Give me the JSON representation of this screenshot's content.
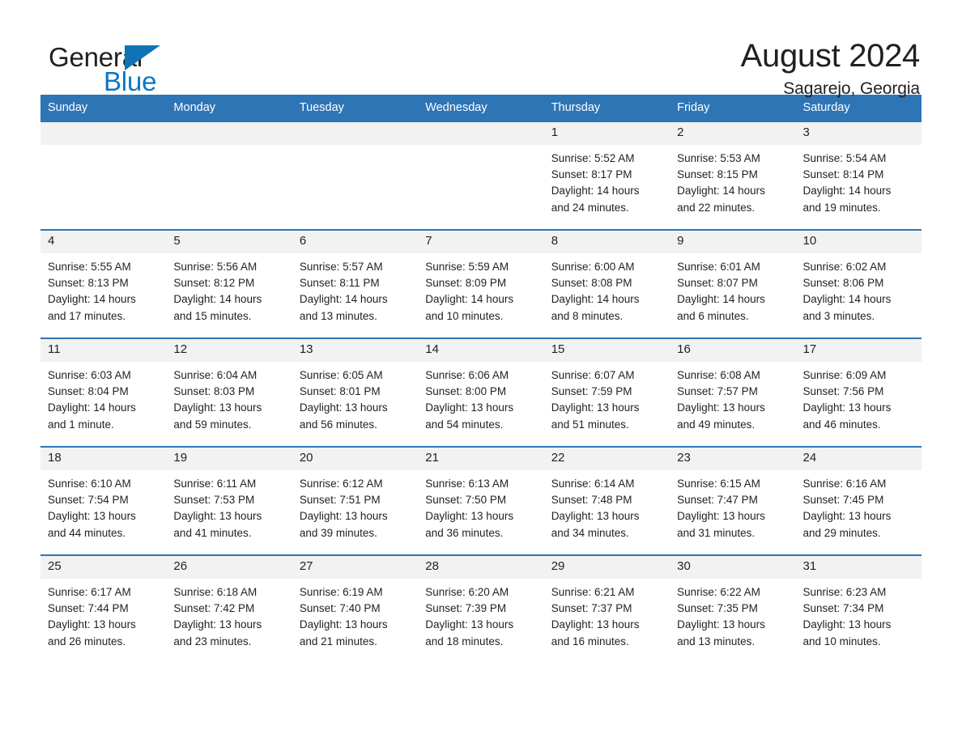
{
  "brand": {
    "word_one": "General",
    "word_two": "Blue",
    "triangle_icon": "triangle-icon",
    "accent_color": "#1073b6",
    "text_color": "#231f20"
  },
  "header": {
    "title": "August 2024",
    "subtitle": "Sagarejo, Georgia"
  },
  "theme": {
    "header_bg": "#2e75b6",
    "header_text": "#ffffff",
    "daynum_bg": "#f2f2f2",
    "body_text": "#231f20"
  },
  "weekdays": [
    "Sunday",
    "Monday",
    "Tuesday",
    "Wednesday",
    "Thursday",
    "Friday",
    "Saturday"
  ],
  "weeks": [
    [
      {
        "day": "",
        "blank": true
      },
      {
        "day": "",
        "blank": true
      },
      {
        "day": "",
        "blank": true
      },
      {
        "day": "",
        "blank": true
      },
      {
        "day": "1",
        "sunrise": "Sunrise: 5:52 AM",
        "sunset": "Sunset: 8:17 PM",
        "daylight_line1": "Daylight: 14 hours",
        "daylight_line2": "and 24 minutes."
      },
      {
        "day": "2",
        "sunrise": "Sunrise: 5:53 AM",
        "sunset": "Sunset: 8:15 PM",
        "daylight_line1": "Daylight: 14 hours",
        "daylight_line2": "and 22 minutes."
      },
      {
        "day": "3",
        "sunrise": "Sunrise: 5:54 AM",
        "sunset": "Sunset: 8:14 PM",
        "daylight_line1": "Daylight: 14 hours",
        "daylight_line2": "and 19 minutes."
      }
    ],
    [
      {
        "day": "4",
        "sunrise": "Sunrise: 5:55 AM",
        "sunset": "Sunset: 8:13 PM",
        "daylight_line1": "Daylight: 14 hours",
        "daylight_line2": "and 17 minutes."
      },
      {
        "day": "5",
        "sunrise": "Sunrise: 5:56 AM",
        "sunset": "Sunset: 8:12 PM",
        "daylight_line1": "Daylight: 14 hours",
        "daylight_line2": "and 15 minutes."
      },
      {
        "day": "6",
        "sunrise": "Sunrise: 5:57 AM",
        "sunset": "Sunset: 8:11 PM",
        "daylight_line1": "Daylight: 14 hours",
        "daylight_line2": "and 13 minutes."
      },
      {
        "day": "7",
        "sunrise": "Sunrise: 5:59 AM",
        "sunset": "Sunset: 8:09 PM",
        "daylight_line1": "Daylight: 14 hours",
        "daylight_line2": "and 10 minutes."
      },
      {
        "day": "8",
        "sunrise": "Sunrise: 6:00 AM",
        "sunset": "Sunset: 8:08 PM",
        "daylight_line1": "Daylight: 14 hours",
        "daylight_line2": "and 8 minutes."
      },
      {
        "day": "9",
        "sunrise": "Sunrise: 6:01 AM",
        "sunset": "Sunset: 8:07 PM",
        "daylight_line1": "Daylight: 14 hours",
        "daylight_line2": "and 6 minutes."
      },
      {
        "day": "10",
        "sunrise": "Sunrise: 6:02 AM",
        "sunset": "Sunset: 8:06 PM",
        "daylight_line1": "Daylight: 14 hours",
        "daylight_line2": "and 3 minutes."
      }
    ],
    [
      {
        "day": "11",
        "sunrise": "Sunrise: 6:03 AM",
        "sunset": "Sunset: 8:04 PM",
        "daylight_line1": "Daylight: 14 hours",
        "daylight_line2": "and 1 minute."
      },
      {
        "day": "12",
        "sunrise": "Sunrise: 6:04 AM",
        "sunset": "Sunset: 8:03 PM",
        "daylight_line1": "Daylight: 13 hours",
        "daylight_line2": "and 59 minutes."
      },
      {
        "day": "13",
        "sunrise": "Sunrise: 6:05 AM",
        "sunset": "Sunset: 8:01 PM",
        "daylight_line1": "Daylight: 13 hours",
        "daylight_line2": "and 56 minutes."
      },
      {
        "day": "14",
        "sunrise": "Sunrise: 6:06 AM",
        "sunset": "Sunset: 8:00 PM",
        "daylight_line1": "Daylight: 13 hours",
        "daylight_line2": "and 54 minutes."
      },
      {
        "day": "15",
        "sunrise": "Sunrise: 6:07 AM",
        "sunset": "Sunset: 7:59 PM",
        "daylight_line1": "Daylight: 13 hours",
        "daylight_line2": "and 51 minutes."
      },
      {
        "day": "16",
        "sunrise": "Sunrise: 6:08 AM",
        "sunset": "Sunset: 7:57 PM",
        "daylight_line1": "Daylight: 13 hours",
        "daylight_line2": "and 49 minutes."
      },
      {
        "day": "17",
        "sunrise": "Sunrise: 6:09 AM",
        "sunset": "Sunset: 7:56 PM",
        "daylight_line1": "Daylight: 13 hours",
        "daylight_line2": "and 46 minutes."
      }
    ],
    [
      {
        "day": "18",
        "sunrise": "Sunrise: 6:10 AM",
        "sunset": "Sunset: 7:54 PM",
        "daylight_line1": "Daylight: 13 hours",
        "daylight_line2": "and 44 minutes."
      },
      {
        "day": "19",
        "sunrise": "Sunrise: 6:11 AM",
        "sunset": "Sunset: 7:53 PM",
        "daylight_line1": "Daylight: 13 hours",
        "daylight_line2": "and 41 minutes."
      },
      {
        "day": "20",
        "sunrise": "Sunrise: 6:12 AM",
        "sunset": "Sunset: 7:51 PM",
        "daylight_line1": "Daylight: 13 hours",
        "daylight_line2": "and 39 minutes."
      },
      {
        "day": "21",
        "sunrise": "Sunrise: 6:13 AM",
        "sunset": "Sunset: 7:50 PM",
        "daylight_line1": "Daylight: 13 hours",
        "daylight_line2": "and 36 minutes."
      },
      {
        "day": "22",
        "sunrise": "Sunrise: 6:14 AM",
        "sunset": "Sunset: 7:48 PM",
        "daylight_line1": "Daylight: 13 hours",
        "daylight_line2": "and 34 minutes."
      },
      {
        "day": "23",
        "sunrise": "Sunrise: 6:15 AM",
        "sunset": "Sunset: 7:47 PM",
        "daylight_line1": "Daylight: 13 hours",
        "daylight_line2": "and 31 minutes."
      },
      {
        "day": "24",
        "sunrise": "Sunrise: 6:16 AM",
        "sunset": "Sunset: 7:45 PM",
        "daylight_line1": "Daylight: 13 hours",
        "daylight_line2": "and 29 minutes."
      }
    ],
    [
      {
        "day": "25",
        "sunrise": "Sunrise: 6:17 AM",
        "sunset": "Sunset: 7:44 PM",
        "daylight_line1": "Daylight: 13 hours",
        "daylight_line2": "and 26 minutes."
      },
      {
        "day": "26",
        "sunrise": "Sunrise: 6:18 AM",
        "sunset": "Sunset: 7:42 PM",
        "daylight_line1": "Daylight: 13 hours",
        "daylight_line2": "and 23 minutes."
      },
      {
        "day": "27",
        "sunrise": "Sunrise: 6:19 AM",
        "sunset": "Sunset: 7:40 PM",
        "daylight_line1": "Daylight: 13 hours",
        "daylight_line2": "and 21 minutes."
      },
      {
        "day": "28",
        "sunrise": "Sunrise: 6:20 AM",
        "sunset": "Sunset: 7:39 PM",
        "daylight_line1": "Daylight: 13 hours",
        "daylight_line2": "and 18 minutes."
      },
      {
        "day": "29",
        "sunrise": "Sunrise: 6:21 AM",
        "sunset": "Sunset: 7:37 PM",
        "daylight_line1": "Daylight: 13 hours",
        "daylight_line2": "and 16 minutes."
      },
      {
        "day": "30",
        "sunrise": "Sunrise: 6:22 AM",
        "sunset": "Sunset: 7:35 PM",
        "daylight_line1": "Daylight: 13 hours",
        "daylight_line2": "and 13 minutes."
      },
      {
        "day": "31",
        "sunrise": "Sunrise: 6:23 AM",
        "sunset": "Sunset: 7:34 PM",
        "daylight_line1": "Daylight: 13 hours",
        "daylight_line2": "and 10 minutes."
      }
    ]
  ]
}
